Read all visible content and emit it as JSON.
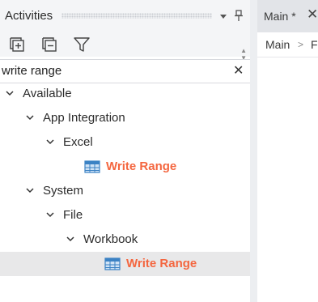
{
  "activities_panel": {
    "title": "Activities",
    "header_icons": [
      "dropdown-icon",
      "pin-icon"
    ],
    "toolbar_icons": [
      "expand-all-icon",
      "collapse-all-icon",
      "filter-icon"
    ],
    "search": {
      "value": "write range",
      "placeholder": ""
    },
    "tree": {
      "available": "Available",
      "app_integration": "App Integration",
      "excel": "Excel",
      "excel_write_range": "Write Range",
      "system": "System",
      "file": "File",
      "workbook": "Workbook",
      "workbook_write_range": "Write Range"
    },
    "activity_color": "#f4663f",
    "selected_color": "#e8e8e9"
  },
  "editor": {
    "tab_label": "Main *",
    "breadcrumb": [
      "Main",
      "Fl"
    ]
  }
}
